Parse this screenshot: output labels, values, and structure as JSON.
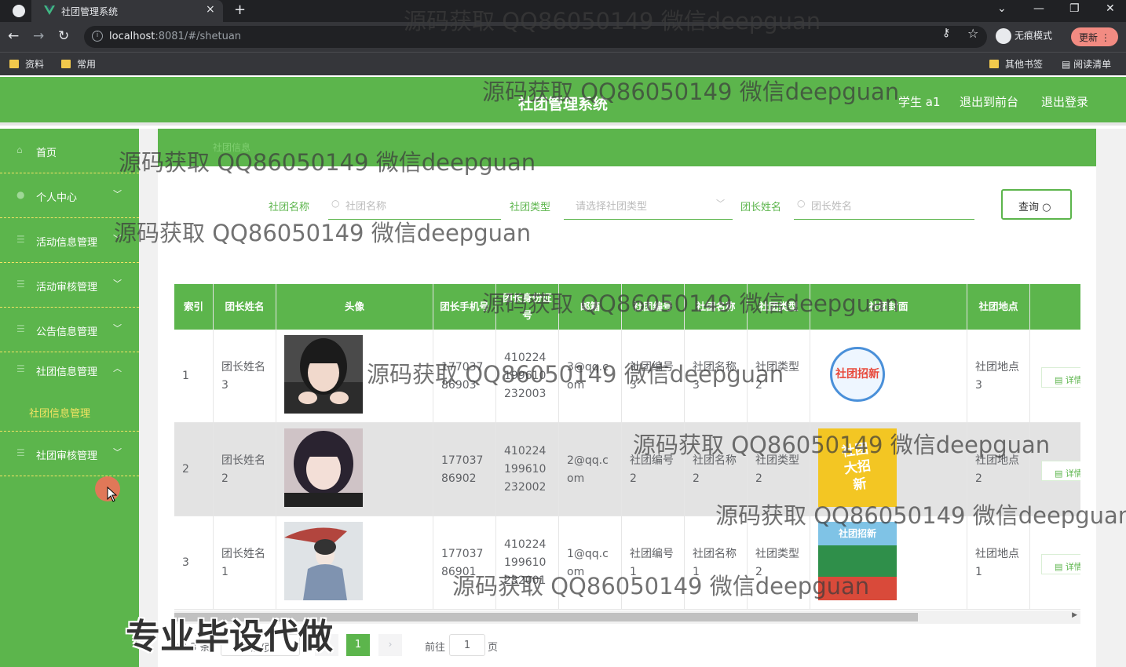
{
  "browser": {
    "tab_title": "社团管理系统",
    "tab_close": "×",
    "new_tab": "+",
    "url_host": "localhost",
    "url_rest": ":8081/#/shetuan",
    "incognito_label": "无痕模式",
    "update_label": "更新",
    "bookmarks": [
      "资料",
      "常用"
    ],
    "other_bookmarks": "其他书签",
    "reading_list": "阅读清单"
  },
  "header": {
    "title": "社团管理系统",
    "user": "学生 a1",
    "back_front": "退出到前台",
    "logout": "退出登录"
  },
  "sidebar": {
    "items": [
      {
        "label": "首页",
        "icon": "home-icon",
        "arrow": ""
      },
      {
        "label": "个人中心",
        "icon": "user-icon",
        "arrow": "﹀"
      },
      {
        "label": "活动信息管理",
        "icon": "menu-icon",
        "arrow": "﹀"
      },
      {
        "label": "活动审核管理",
        "icon": "menu-icon",
        "arrow": "﹀"
      },
      {
        "label": "公告信息管理",
        "icon": "menu-icon",
        "arrow": "﹀"
      },
      {
        "label": "社团信息管理",
        "icon": "menu-icon",
        "arrow": "︿"
      },
      {
        "label": "社团审核管理",
        "icon": "menu-icon",
        "arrow": "﹀"
      }
    ],
    "submenu_label": "社团信息管理"
  },
  "breadcrumb": "社团信息",
  "filters": {
    "name_label": "社团名称",
    "name_placeholder": "社团名称",
    "type_label": "社团类型",
    "type_placeholder": "请选择社团类型",
    "leader_label": "团长姓名",
    "leader_placeholder": "团长姓名",
    "query_button": "查询"
  },
  "table": {
    "headers": [
      "索引",
      "团长姓名",
      "头像",
      "团长手机号",
      "团长身份证号",
      "邮箱",
      "社团编号",
      "社团名称",
      "社团类型",
      "社团封面",
      "社团地点",
      ""
    ],
    "rows": [
      {
        "index": "1",
        "leader": "团长姓名3",
        "phone": "17703786903",
        "id_card": "410224199610232003",
        "email": "3@qq.com",
        "code": "社团编号3",
        "name": "社团名称3",
        "type": "社团类型2",
        "place": "社团地点3",
        "cover": "社团招新",
        "action": "详情"
      },
      {
        "index": "2",
        "leader": "团长姓名2",
        "phone": "17703786902",
        "id_card": "410224199610232002",
        "email": "2@qq.com",
        "code": "社团编号2",
        "name": "社团名称2",
        "type": "社团类型2",
        "place": "社团地点2",
        "cover": "社团大招新",
        "action": "详情"
      },
      {
        "index": "3",
        "leader": "团长姓名1",
        "phone": "17703786901",
        "id_card": "410224199610232001",
        "email": "1@qq.com",
        "code": "社团编号1",
        "name": "社团名称1",
        "type": "社团类型2",
        "place": "社团地点1",
        "cover": "社团招新",
        "action": "详情"
      }
    ]
  },
  "pagination": {
    "total": "共 3 条",
    "page_size": "10条/页",
    "prev": "‹",
    "current": "1",
    "next": "›",
    "goto": "前往",
    "goto_value": "1",
    "page_unit": "页"
  },
  "watermarks": {
    "text": "源码获取 QQ86050149 微信deepguan",
    "big": "专业毕设代做"
  }
}
